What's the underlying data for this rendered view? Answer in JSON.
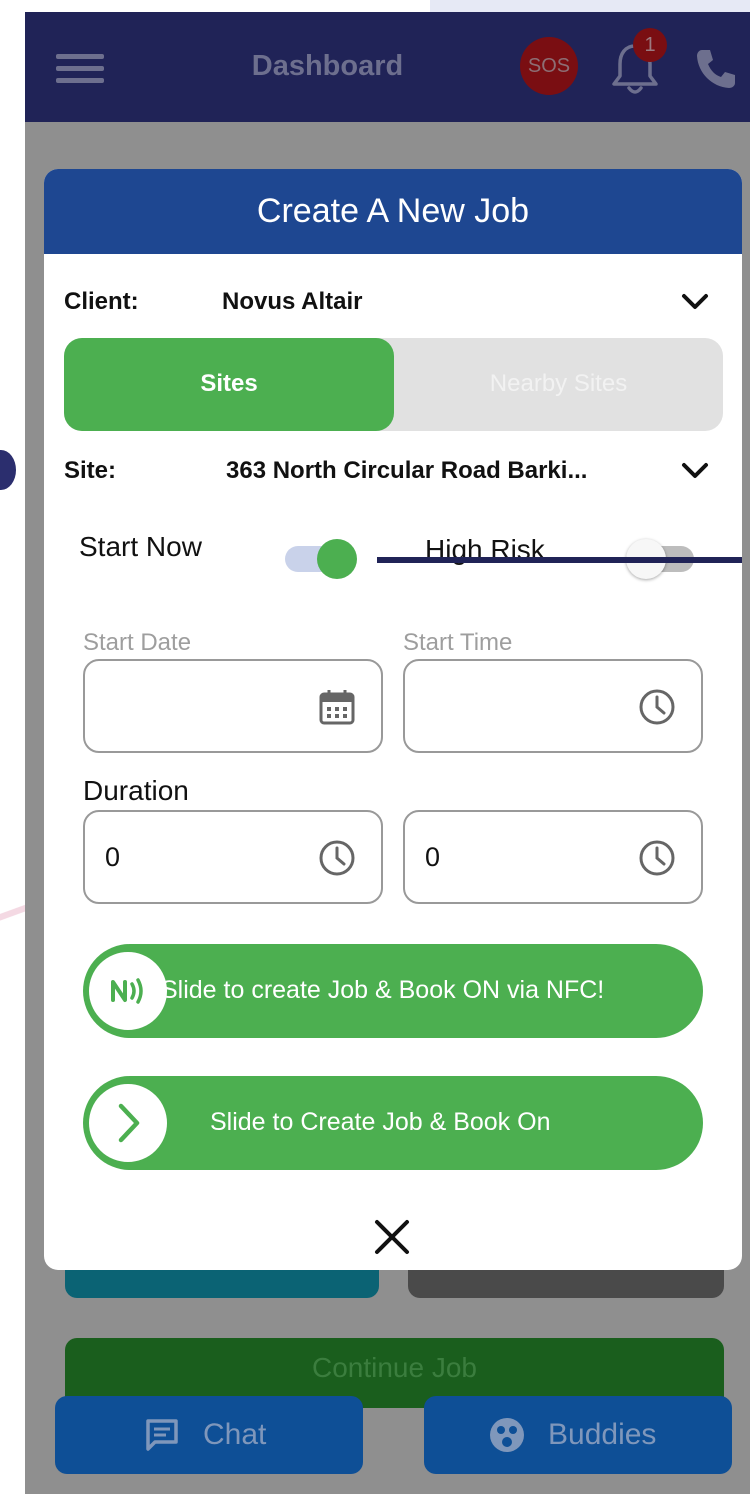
{
  "appbar": {
    "title": "Dashboard",
    "sos_label": "SOS",
    "notification_count": "1"
  },
  "modal": {
    "title": "Create A New Job",
    "client_label": "Client:",
    "client_value": "Novus Altair",
    "tabs": [
      {
        "label": "Sites",
        "active": true
      },
      {
        "label": "Nearby Sites",
        "active": false
      }
    ],
    "site_label": "Site:",
    "site_value": "363 North Circular Road Barki...",
    "start_now_label": "Start Now",
    "start_now_on": true,
    "high_risk_label": "High Risk",
    "high_risk_on": false,
    "start_date_label": "Start Date",
    "start_time_label": "Start Time",
    "duration_label": "Duration",
    "duration_hours": "0",
    "duration_minutes": "0",
    "nfc_slide_label": "Slide to create Job & Book ON via NFC!",
    "create_slide_label": "Slide to Create Job & Book On"
  },
  "background": {
    "continue_label": "Continue Job",
    "chat_label": "Chat",
    "buddies_label": "Buddies"
  },
  "colors": {
    "appbar": "#202357",
    "modal_header": "#1e4791",
    "accent_green": "#4caf50",
    "sos_red": "#7a0e12"
  },
  "icons": {
    "menu": "hamburger-icon",
    "sos": "sos-icon",
    "bell": "bell-icon",
    "phone": "phone-icon",
    "calendar": "calendar-icon",
    "clock": "clock-icon",
    "nfc": "nfc-icon",
    "arrow": "chevron-right-icon",
    "close": "close-icon",
    "chat": "chat-icon",
    "buddies": "buddies-icon"
  }
}
